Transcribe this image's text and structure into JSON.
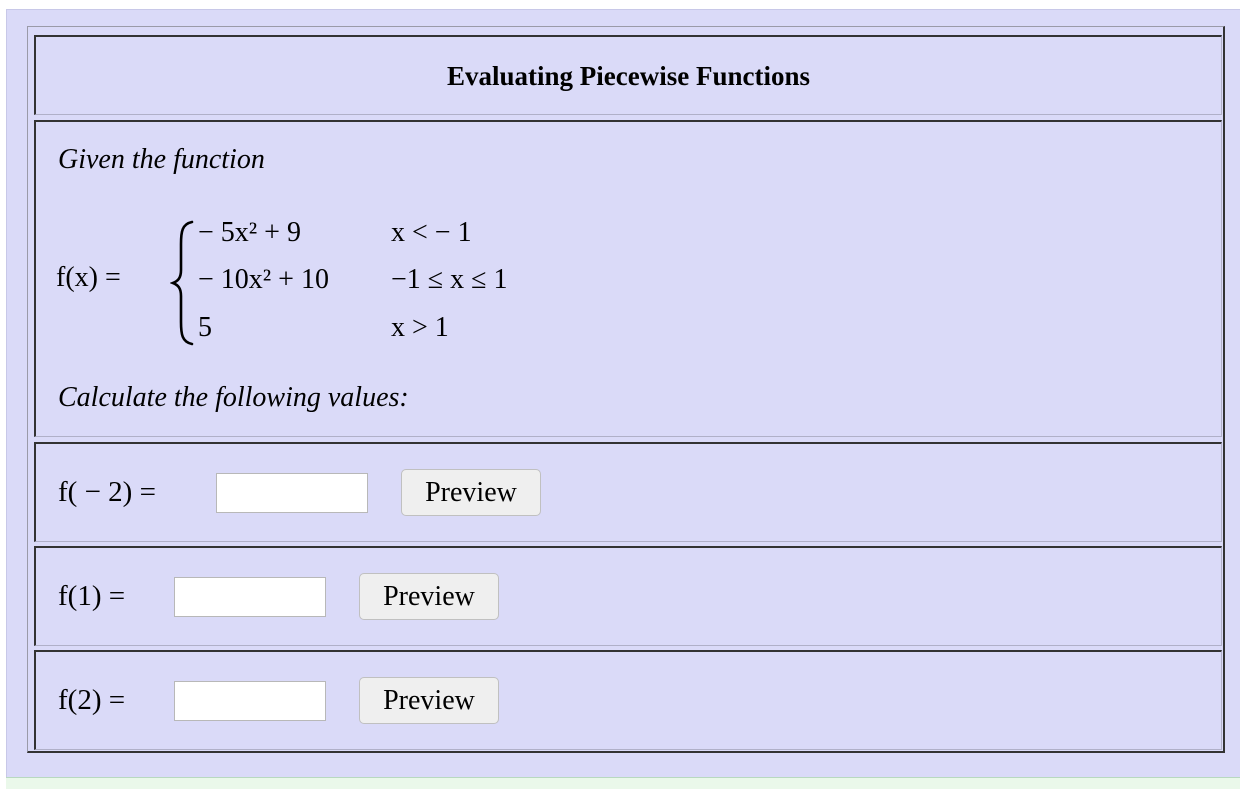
{
  "title": "Evaluating Piecewise Functions",
  "intro": "Given the function",
  "function_name": "f(x) =",
  "cases": [
    {
      "expr": "− 5x² + 9",
      "cond": "x <  − 1"
    },
    {
      "expr": "− 10x² + 10",
      "cond": "−1 ≤ x ≤ 1"
    },
    {
      "expr": "5",
      "cond": "x > 1"
    }
  ],
  "prompt": "Calculate the following values:",
  "questions": [
    {
      "label": "f( − 2) =",
      "value": "",
      "button": "Preview"
    },
    {
      "label": "f(1) =",
      "value": "",
      "button": "Preview"
    },
    {
      "label": "f(2) =",
      "value": "",
      "button": "Preview"
    }
  ]
}
